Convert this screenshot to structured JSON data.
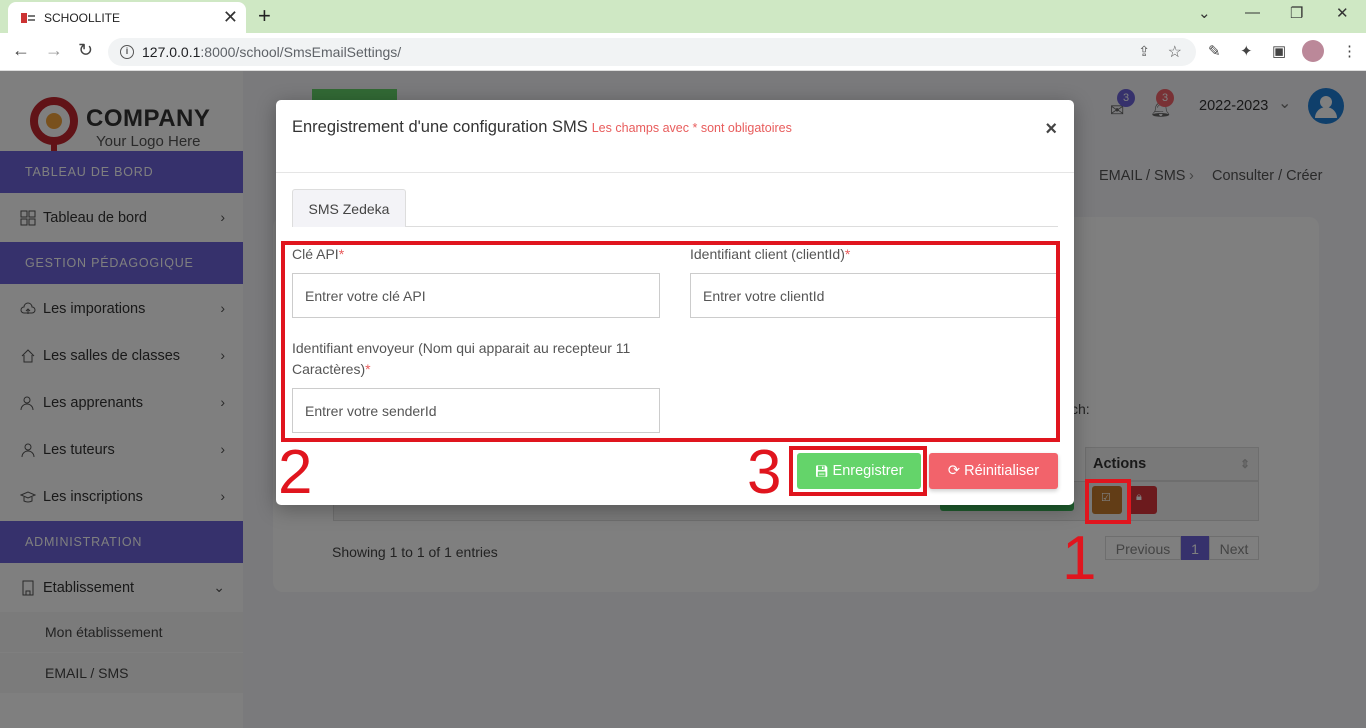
{
  "browser": {
    "tab_title": "SCHOOLLITE",
    "url_host": "127.0.0.1",
    "url_path": ":8000/school/SmsEmailSettings/"
  },
  "sidebar": {
    "logo_brand": "COMPANY",
    "logo_tagline": "Your Logo Here",
    "sections": [
      {
        "label": "TABLEAU DE BORD"
      },
      {
        "label": "GESTION PÉDAGOGIQUE"
      },
      {
        "label": "ADMINISTRATION"
      }
    ],
    "items": [
      {
        "label": "Tableau de bord",
        "icon": "dashboard-icon"
      },
      {
        "label": "Les imporations",
        "icon": "cloud-upload-icon"
      },
      {
        "label": "Les salles de classes",
        "icon": "home-icon"
      },
      {
        "label": "Les apprenants",
        "icon": "users-icon"
      },
      {
        "label": "Les tuteurs",
        "icon": "user-icon"
      },
      {
        "label": "Les inscriptions",
        "icon": "graduation-cap-icon"
      },
      {
        "label": "Etablissement",
        "icon": "building-icon"
      }
    ],
    "subitems": [
      {
        "label": "Mon établissement"
      },
      {
        "label": "EMAIL / SMS"
      }
    ]
  },
  "header": {
    "mail_count": "3",
    "notif_count": "3",
    "school_year": "2022-2023"
  },
  "breadcrumb": {
    "item1": "EMAIL / SMS",
    "item2": "Consulter / Créer"
  },
  "table": {
    "search_tail": "ch:",
    "actions_header": "Actions",
    "showing": "Showing 1 to 1 of 1 entries",
    "pager_prev": "Previous",
    "pager_current": "1",
    "pager_next": "Next"
  },
  "modal": {
    "title": "Enregistrement d'une configuration SMS",
    "required_note": "Les champs avec * sont obligatoires",
    "close": "×",
    "tab": "SMS Zedeka",
    "fields": {
      "api_key_label": "Clé API",
      "api_key_placeholder": "Entrer votre clé API",
      "client_id_label": "Identifiant client (clientId)",
      "client_id_placeholder": "Entrer votre clientId",
      "sender_label_line1": "Identifiant envoyeur (Nom qui apparait au recepteur 11",
      "sender_label_line2": "Caractères)",
      "sender_placeholder": "Entrer votre senderId",
      "required_mark": "*"
    },
    "save_button": "Enregistrer",
    "reset_button": "Réinitialiser"
  },
  "annotations": {
    "n1": "1",
    "n2": "2",
    "n3": "3"
  },
  "colors": {
    "accent_purple": "#6c63d9",
    "save_green": "#64d46a",
    "reset_red": "#f2636b",
    "annotation_red": "#e0151e"
  }
}
